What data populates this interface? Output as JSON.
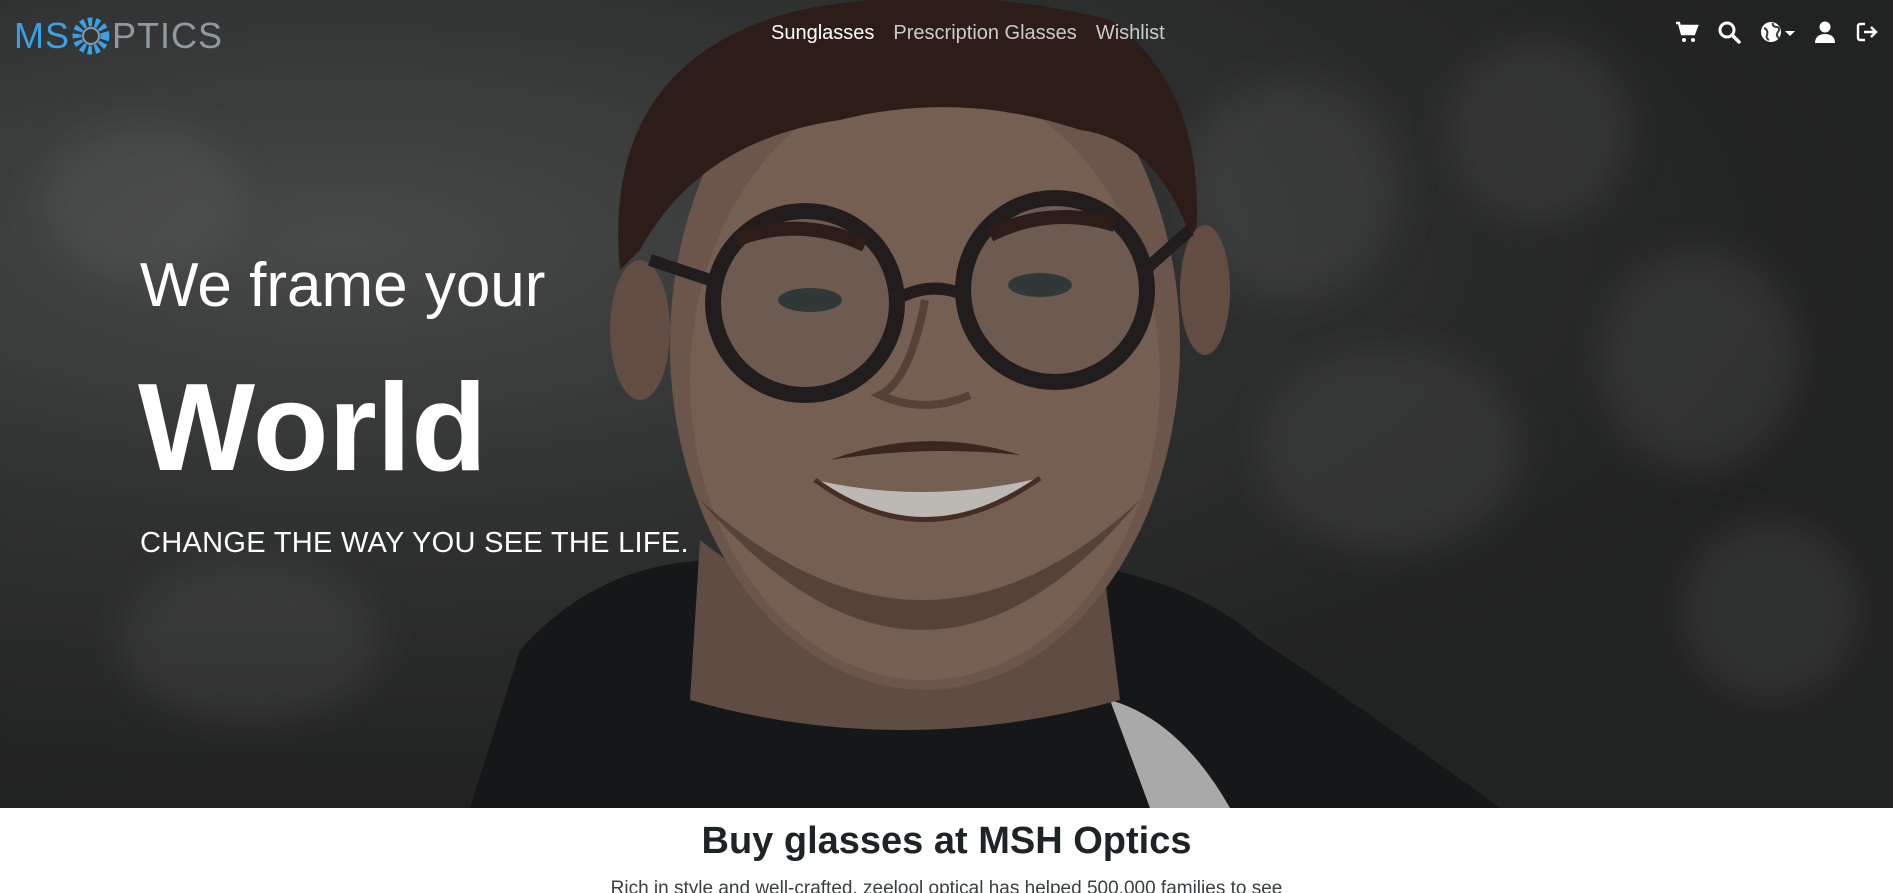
{
  "brand": {
    "logo_left": "MS",
    "logo_right": "PTICS",
    "ring_color": "#3aa0e8"
  },
  "nav": {
    "links": [
      {
        "label": "Sunglasses",
        "active": true
      },
      {
        "label": "Prescription Glasses",
        "active": false
      },
      {
        "label": "Wishlist",
        "active": false
      }
    ],
    "icons": [
      "cart-icon",
      "search-icon",
      "globe-icon",
      "user-icon",
      "logout-icon"
    ]
  },
  "hero": {
    "tagline": "We frame your",
    "headline": "World",
    "subtitle": "CHANGE THE WAY YOU SEE THE LIFE."
  },
  "intro": {
    "title": "Buy glasses at MSH Optics",
    "text": "Rich in style and well-crafted, zeelool optical has helped 500,000 families to see"
  }
}
